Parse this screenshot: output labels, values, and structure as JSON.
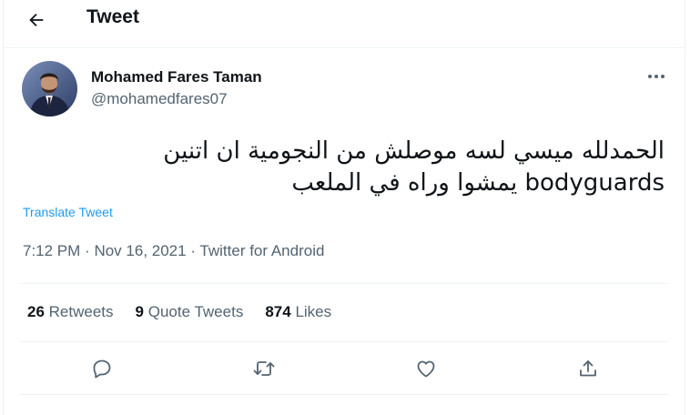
{
  "header": {
    "title": "Tweet"
  },
  "author": {
    "name": "Mohamed Fares Taman",
    "handle": "@mohamedfares07"
  },
  "tweet": {
    "line1": "الحمدلله ميسي لسه موصلش من النجومية ان اتنين",
    "line2": "bodyguards يمشوا وراه في الملعب",
    "translate_label": "Translate Tweet",
    "time": "7:12 PM",
    "date": "Nov 16, 2021",
    "source": "Twitter for Android",
    "meta_sep": "·"
  },
  "stats": {
    "retweets_count": "26",
    "retweets_label": "Retweets",
    "quotes_count": "9",
    "quotes_label": "Quote Tweets",
    "likes_count": "874",
    "likes_label": "Likes"
  },
  "icons": {
    "back": "back-arrow-icon",
    "more": "more-dots-icon",
    "reply": "reply-icon",
    "retweet": "retweet-icon",
    "like": "heart-icon",
    "share": "share-icon"
  },
  "colors": {
    "accent": "#1d9bf0",
    "secondary_text": "#536471",
    "divider": "#eff3f4"
  }
}
